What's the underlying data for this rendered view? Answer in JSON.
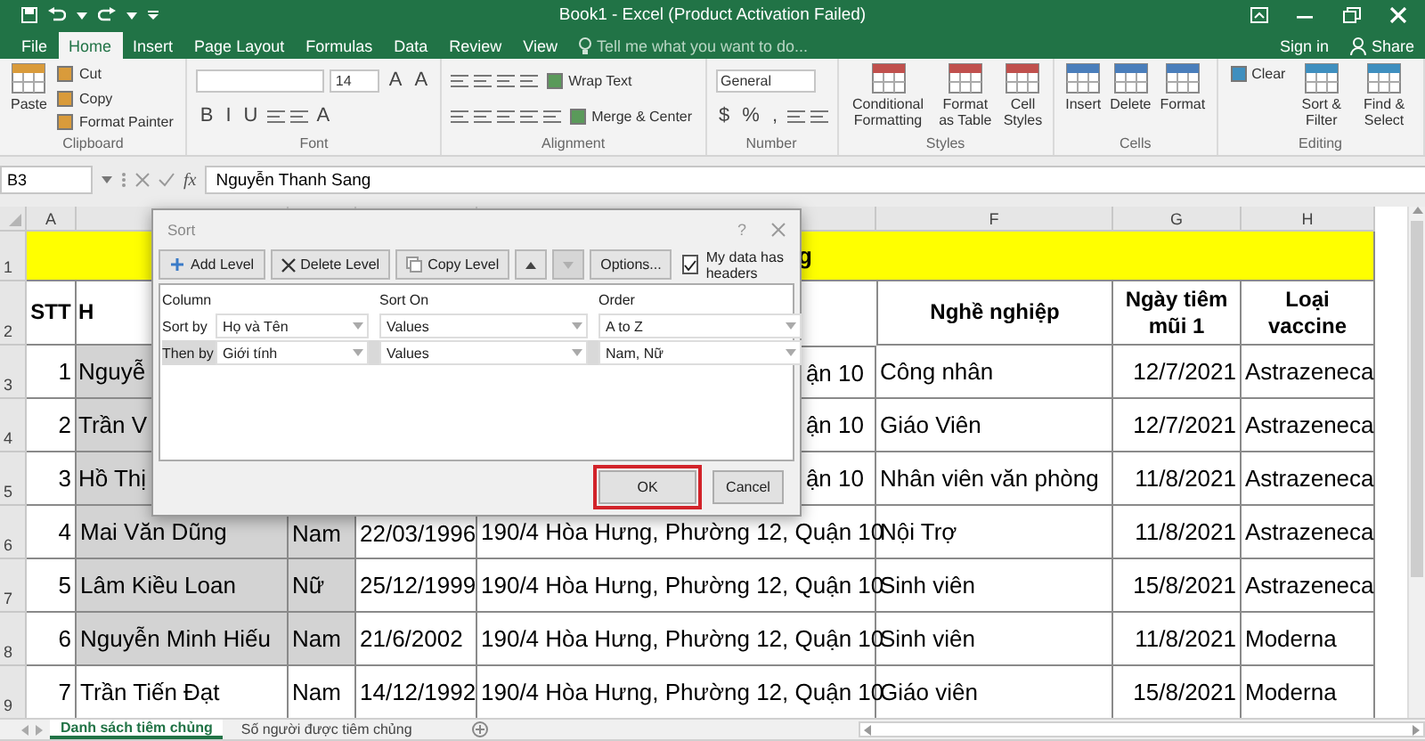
{
  "window": {
    "title": "Book1 - Excel (Product Activation Failed)"
  },
  "tabs": [
    {
      "label": "File",
      "selected": false
    },
    {
      "label": "Home",
      "selected": true
    },
    {
      "label": "Insert",
      "selected": false
    },
    {
      "label": "Page Layout",
      "selected": false
    },
    {
      "label": "Formulas",
      "selected": false
    },
    {
      "label": "Data",
      "selected": false
    },
    {
      "label": "Review",
      "selected": false
    },
    {
      "label": "View",
      "selected": false
    }
  ],
  "tell_me": {
    "placeholder": "Tell me what you want to do..."
  },
  "account": {
    "sign_in": "Sign in",
    "share": "Share"
  },
  "ribbon": {
    "groups": [
      {
        "label": "Clipboard",
        "items": [
          {
            "kind": "large",
            "label": "Paste"
          },
          {
            "kind": "small",
            "label": "Cut"
          },
          {
            "kind": "small",
            "label": "Copy"
          },
          {
            "kind": "small",
            "label": "Format Painter"
          }
        ]
      },
      {
        "label": "Font",
        "items": [
          {
            "kind": "strip",
            "parts": [
              {
                "kind": "field"
              },
              {
                "kind": "field",
                "value": "14"
              },
              {
                "kind": "glyph",
                "text": "A"
              },
              {
                "kind": "glyph",
                "text": "A"
              }
            ]
          },
          {
            "kind": "strip",
            "parts": [
              {
                "kind": "glyph",
                "text": "B"
              },
              {
                "kind": "glyph",
                "text": "I"
              },
              {
                "kind": "glyph",
                "text": "U"
              },
              {
                "kind": "icon"
              },
              {
                "kind": "icon"
              },
              {
                "kind": "glyph",
                "text": "A"
              }
            ]
          }
        ]
      },
      {
        "label": "Alignment",
        "items": [
          {
            "kind": "strip",
            "parts": [
              {
                "kind": "icon"
              },
              {
                "kind": "icon"
              },
              {
                "kind": "icon"
              },
              {
                "kind": "icon"
              },
              {
                "kind": "button",
                "label": "Wrap Text"
              }
            ]
          },
          {
            "kind": "strip",
            "parts": [
              {
                "kind": "icon"
              },
              {
                "kind": "icon"
              },
              {
                "kind": "icon"
              },
              {
                "kind": "icon"
              },
              {
                "kind": "icon"
              },
              {
                "kind": "button",
                "label": "Merge & Center"
              }
            ]
          }
        ]
      },
      {
        "label": "Number",
        "items": [
          {
            "kind": "strip",
            "parts": [
              {
                "kind": "field",
                "value": "General"
              }
            ]
          },
          {
            "kind": "strip",
            "parts": [
              {
                "kind": "glyph",
                "text": "$"
              },
              {
                "kind": "glyph",
                "text": "%"
              },
              {
                "kind": "glyph",
                "text": ","
              },
              {
                "kind": "icon"
              },
              {
                "kind": "icon"
              }
            ]
          }
        ]
      },
      {
        "label": "Styles",
        "items": [
          {
            "kind": "large",
            "label": "Conditional Formatting"
          },
          {
            "kind": "large",
            "label": "Format as Table"
          },
          {
            "kind": "large",
            "label": "Cell Styles"
          }
        ]
      },
      {
        "label": "Cells",
        "items": [
          {
            "kind": "large",
            "label": "Insert"
          },
          {
            "kind": "large",
            "label": "Delete"
          },
          {
            "kind": "large",
            "label": "Format"
          }
        ]
      },
      {
        "label": "Editing",
        "items": [
          {
            "kind": "small",
            "label": "Clear"
          },
          {
            "kind": "large",
            "label": "Sort & Filter"
          },
          {
            "kind": "large",
            "label": "Find & Select"
          }
        ]
      }
    ]
  },
  "formula_bar": {
    "cell": "B3",
    "function_label": "fx",
    "value": "Nguyễn Thanh Sang"
  },
  "sheet": {
    "columns": [
      {
        "header": "A",
        "kind": "number"
      },
      {
        "kind": "text"
      },
      {
        "kind": "text"
      },
      {
        "kind": "text"
      },
      {
        "kind": "text"
      },
      {
        "header": "F",
        "kind": "text"
      },
      {
        "header": "G",
        "kind": "number"
      },
      {
        "header": "H",
        "kind": "text"
      }
    ],
    "rows": [
      {
        "header": "1",
        "kind": "title",
        "text": "g"
      },
      {
        "header": "2",
        "kind": "header",
        "cells": [
          {
            "text": "STT"
          },
          {
            "text": "H",
            "kind": "head"
          },
          null,
          null,
          null,
          {
            "text": "Nghề nghiệp"
          },
          {
            "text": "Ngày tiêm mũi 1"
          },
          {
            "text": "Loại vaccine"
          }
        ]
      },
      {
        "header": "3",
        "kind": "data",
        "cells": [
          {
            "text": "1",
            "selected": false
          },
          {
            "text": "Nguyễ",
            "kind": "head",
            "selected": true
          },
          null,
          null,
          {
            "text": "ận 10",
            "kind": "tail",
            "selected": false
          },
          {
            "text": "Công nhân",
            "selected": false
          },
          {
            "text": "12/7/2021",
            "selected": false
          },
          {
            "text": "Astrazeneca",
            "selected": false
          }
        ]
      },
      {
        "header": "4",
        "kind": "data",
        "cells": [
          {
            "text": "2",
            "selected": false
          },
          {
            "text": "Trần V",
            "kind": "head",
            "selected": true
          },
          null,
          null,
          {
            "text": "ận 10",
            "kind": "tail",
            "selected": false
          },
          {
            "text": "Giáo Viên",
            "selected": false
          },
          {
            "text": "12/7/2021",
            "selected": false
          },
          {
            "text": "Astrazeneca",
            "selected": false
          }
        ]
      },
      {
        "header": "5",
        "kind": "data",
        "cells": [
          {
            "text": "3",
            "selected": false
          },
          {
            "text": "Hồ Thị",
            "kind": "head",
            "selected": true
          },
          null,
          null,
          {
            "text": "ận 10",
            "kind": "tail",
            "selected": false
          },
          {
            "text": "Nhân viên văn phòng",
            "selected": false
          },
          {
            "text": "11/8/2021",
            "selected": false
          },
          {
            "text": "Astrazeneca",
            "selected": false
          }
        ]
      },
      {
        "header": "6",
        "kind": "data",
        "cells": [
          {
            "text": "4",
            "selected": false
          },
          {
            "text": "Mai Văn Dũng",
            "selected": true
          },
          {
            "text": "Nam",
            "selected": true
          },
          {
            "text": "22/03/1996",
            "selected": false
          },
          {
            "text": "190/4 Hòa Hưng, Phường 12, Quận 10",
            "selected": false
          },
          {
            "text": "Nội Trợ",
            "selected": false
          },
          {
            "text": "11/8/2021",
            "selected": false
          },
          {
            "text": "Astrazeneca",
            "selected": false
          }
        ]
      },
      {
        "header": "7",
        "kind": "data",
        "cells": [
          {
            "text": "5",
            "selected": false
          },
          {
            "text": "Lâm Kiều Loan",
            "selected": true
          },
          {
            "text": "Nữ",
            "selected": true
          },
          {
            "text": "25/12/1999",
            "selected": false
          },
          {
            "text": "190/4 Hòa Hưng, Phường 12, Quận 10",
            "selected": false
          },
          {
            "text": "Sinh viên",
            "selected": false
          },
          {
            "text": "15/8/2021",
            "selected": false
          },
          {
            "text": "Astrazeneca",
            "selected": false
          }
        ]
      },
      {
        "header": "8",
        "kind": "data",
        "cells": [
          {
            "text": "6",
            "selected": false
          },
          {
            "text": "Nguyễn Minh Hiếu",
            "selected": true
          },
          {
            "text": "Nam",
            "selected": true
          },
          {
            "text": "21/6/2002",
            "selected": false
          },
          {
            "text": "190/4 Hòa Hưng, Phường 12, Quận 10",
            "selected": false
          },
          {
            "text": "Sinh viên",
            "selected": false
          },
          {
            "text": "11/8/2021",
            "selected": false
          },
          {
            "text": "Moderna",
            "selected": false
          }
        ]
      },
      {
        "header": "9",
        "kind": "data",
        "cells": [
          {
            "text": "7",
            "selected": false
          },
          {
            "text": "Trần Tiến Đạt",
            "selected": false
          },
          {
            "text": "Nam",
            "selected": false
          },
          {
            "text": "14/12/1992",
            "selected": false
          },
          {
            "text": "190/4 Hòa Hưng, Phường 12, Quận 10",
            "selected": false
          },
          {
            "text": "Giáo viên",
            "selected": false
          },
          {
            "text": "15/8/2021",
            "selected": false
          },
          {
            "text": "Moderna",
            "selected": false
          }
        ]
      }
    ]
  },
  "sort_dialog": {
    "title": "Sort",
    "help": "?",
    "toolbar": [
      {
        "kind": "add",
        "label": "Add Level",
        "disabled": false
      },
      {
        "kind": "delete",
        "label": "Delete Level",
        "disabled": false
      },
      {
        "kind": "copy",
        "label": "Copy Level",
        "disabled": false
      },
      {
        "kind": "up",
        "disabled": false
      },
      {
        "kind": "down",
        "disabled": true
      },
      {
        "kind": "text",
        "label": "Options...",
        "disabled": false
      }
    ],
    "headers_checkbox": {
      "label": "My data has headers",
      "checked": true
    },
    "columns": [
      "Column",
      "Sort On",
      "Order"
    ],
    "levels": [
      {
        "label": "Sort by",
        "column": "Họ và Tên",
        "sort_on": "Values",
        "order": "A to Z",
        "selected": false
      },
      {
        "label": "Then by",
        "column": "Giới tính",
        "sort_on": "Values",
        "order": "Nam, Nữ",
        "selected": true
      }
    ],
    "buttons": [
      {
        "label": "OK",
        "highlighted": true
      },
      {
        "label": "Cancel",
        "highlighted": false
      }
    ]
  },
  "sheet_tabs": [
    {
      "label": "Danh sách tiêm chủng",
      "selected": true
    },
    {
      "label": "Số người được tiêm chủng",
      "selected": false
    }
  ]
}
